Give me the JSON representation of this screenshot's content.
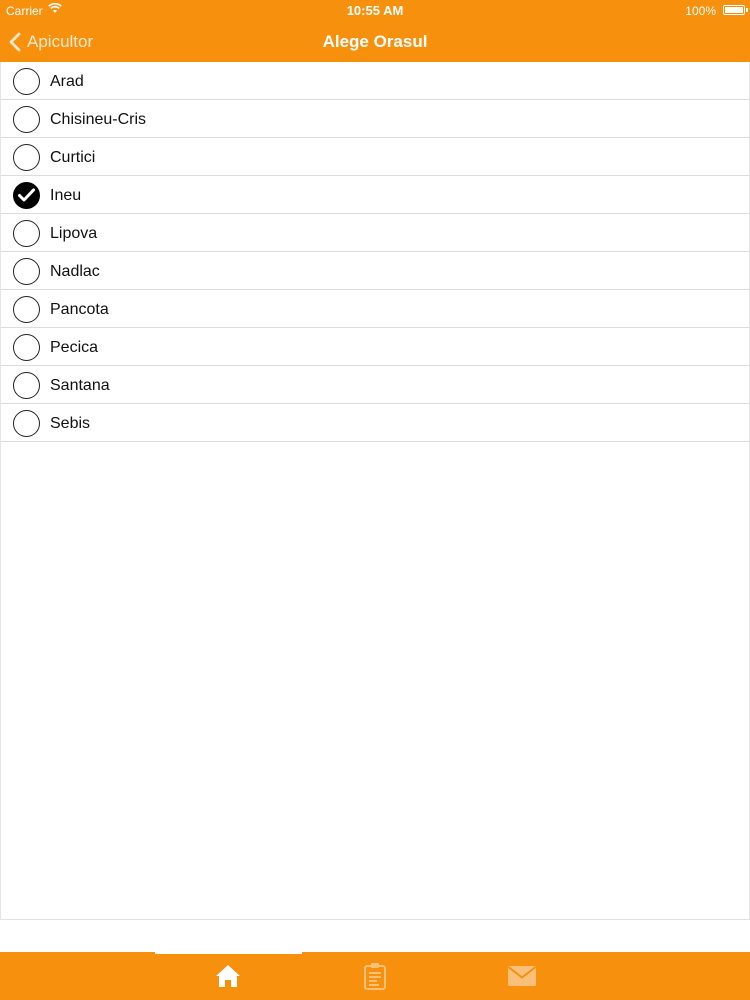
{
  "status_bar": {
    "carrier": "Carrier",
    "time": "10:55 AM",
    "battery": "100%"
  },
  "nav": {
    "back_label": "Apicultor",
    "title": "Alege Orasul"
  },
  "cities": [
    {
      "name": "Arad",
      "selected": false
    },
    {
      "name": "Chisineu-Cris",
      "selected": false
    },
    {
      "name": "Curtici",
      "selected": false
    },
    {
      "name": "Ineu",
      "selected": true
    },
    {
      "name": "Lipova",
      "selected": false
    },
    {
      "name": "Nadlac",
      "selected": false
    },
    {
      "name": "Pancota",
      "selected": false
    },
    {
      "name": "Pecica",
      "selected": false
    },
    {
      "name": "Santana",
      "selected": false
    },
    {
      "name": "Sebis",
      "selected": false
    }
  ],
  "tabs": [
    {
      "icon": "home-icon",
      "active": true
    },
    {
      "icon": "clipboard-icon",
      "active": false
    },
    {
      "icon": "mail-icon",
      "active": false
    }
  ],
  "colors": {
    "accent": "#f7910d",
    "tab_inactive": "#f9c07a",
    "tab_active": "#ffffff"
  }
}
